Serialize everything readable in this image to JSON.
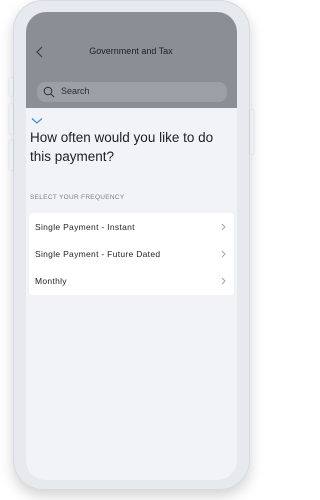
{
  "header": {
    "title": "Government and Tax"
  },
  "search": {
    "label": "Search"
  },
  "sheet": {
    "question": "How often would you like to do this payment?",
    "section_label": "SELECT YOUR FREQUENCY",
    "options": [
      {
        "label": "Single Payment - Instant"
      },
      {
        "label": "Single Payment - Future Dated"
      },
      {
        "label": "Monthly"
      }
    ]
  },
  "colors": {
    "accent": "#3a8fd8",
    "overlay": "#8a8f96",
    "surface": "#f1f3f7",
    "card": "#ffffff"
  },
  "icons": {
    "back": "chevron-left-icon",
    "search": "search-icon",
    "collapse": "chevron-down-icon",
    "option": "chevron-right-icon"
  }
}
